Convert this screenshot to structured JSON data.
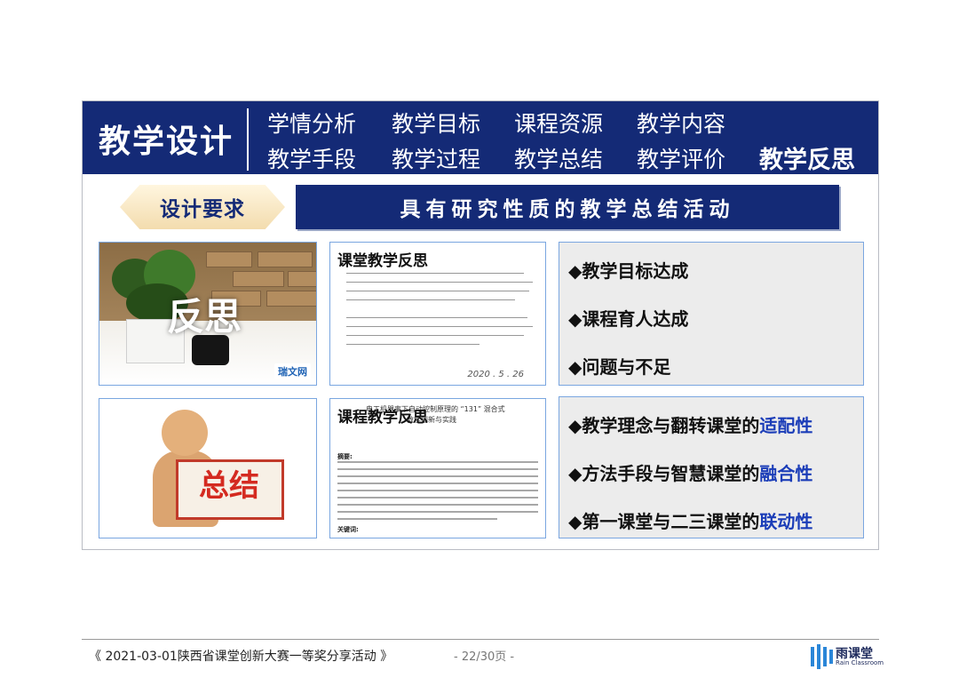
{
  "slide": {
    "header": {
      "title": "教学设计",
      "nav_row1": [
        "学情分析",
        "教学目标",
        "课程资源",
        "教学内容"
      ],
      "nav_row2": [
        "教学手段",
        "教学过程",
        "教学总结",
        "教学评价"
      ],
      "active_item": "教学反思"
    },
    "requirement_label": "设计要求",
    "banner_text": "具有研究性质的教学总结活动",
    "images": {
      "reflection_photo_text": "反思",
      "reflection_photo_logo": "瑞文网",
      "summary_sign_text": "总结"
    },
    "documents": {
      "handwritten_title": "课堂教学反思",
      "handwritten_date": "2020 . 5 . 26",
      "paper_title": "课程教学反思",
      "paper_heading": "电工机器事下自动控制原理的 “131” 混合式",
      "paper_subheading": "教学创新与实践",
      "abstract_label": "摘要:",
      "keywords_label": "关键词:"
    },
    "points_top": [
      "◆教学目标达成",
      "◆课程育人达成",
      "◆问题与不足"
    ],
    "points_bottom": [
      {
        "text": "◆教学理念与翻转课堂的",
        "highlight": "适配性"
      },
      {
        "text": "◆方法手段与智慧课堂的",
        "highlight": "融合性"
      },
      {
        "text": "◆第一课堂与二三课堂的",
        "highlight": "联动性"
      }
    ]
  },
  "footer": {
    "caption": "《 2021-03-01陕西省课堂创新大赛一等奖分享活动 》",
    "page_indicator": "- 22/30页 -",
    "logo_name": "雨课堂",
    "logo_subtitle": "Rain Classroom"
  },
  "colors": {
    "header_blue": "#142a76",
    "highlight_blue": "#1b3db8",
    "summary_red": "#d42a20",
    "badge_gold": "#f3dcae"
  }
}
